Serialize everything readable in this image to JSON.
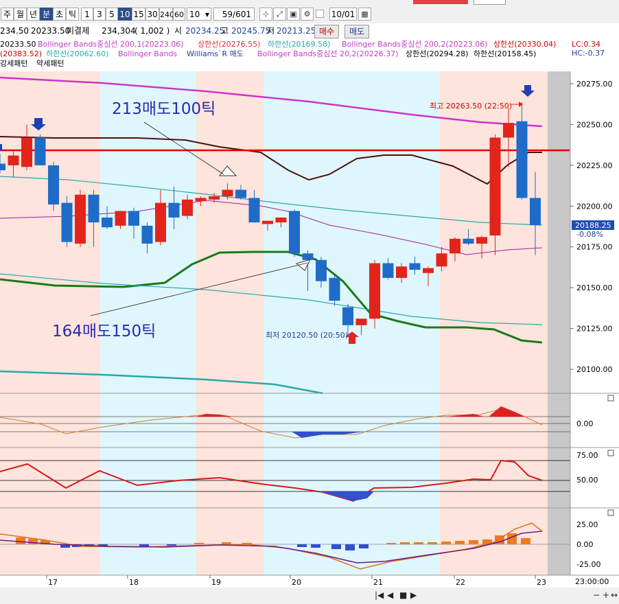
{
  "toolbar": {
    "periods": [
      "주",
      "월",
      "년",
      "분",
      "초",
      "틱"
    ],
    "active_period": "분",
    "intervals": [
      "1",
      "3",
      "5",
      "10",
      "15",
      "30",
      "240",
      "60"
    ],
    "active_interval": "10",
    "count_select": "10",
    "range": "59/601",
    "date_value": "10/01"
  },
  "quote": {
    "p1": "234.50",
    "p2": "20233.50",
    "open_interest_label": "미결제",
    "open_interest": "234,304",
    "oi_change": "( 1,002 )",
    "open_label": "시",
    "open": "20234.25",
    "high_label": "고",
    "high": "20245.75",
    "low_label": "저",
    "low": "20213.25",
    "buy_label": "매수",
    "sell_label": "매도"
  },
  "legend": {
    "l1a": "20233.50",
    "l1b": "Bollinger Bands중심선 200,1(20223.06)",
    "l1c": "상한선(20276.55)",
    "l1d": "하한선(20169.58)",
    "l1e": "Bollinger Bands중심선 200,2(20223.06)",
    "l1f": "상한선(20330.04)",
    "l2a": "(20383.52)",
    "l2b": "하한선(20062.60)",
    "l2c": "Bollinger Bands",
    "l2d": "Williams`R 매도",
    "l2e": "Bollinger Bands중심선 20,2(20226.37)",
    "l2f": "상한선(20294.28)",
    "l2g": "하한선(20158.45)",
    "l3a": "강세패턴",
    "l3b": "약세패턴",
    "lc": "LC:0.34",
    "hc": "HC:-0.37"
  },
  "annotations": {
    "sell1": "213매도100틱",
    "sell2": "164매도150틱",
    "high_note": "최고 20263.50 (22:50)",
    "low_note": "최저 20120.50 (20:50)"
  },
  "price_box": {
    "price": "20188.25",
    "change": "-0.08%"
  },
  "bottom_right_time": "23:00:00",
  "colors": {
    "up": "#e3241b",
    "down": "#1f6cc8",
    "band_pink": "#fde4dc",
    "band_cyan": "#dff6fc",
    "ref_line": "#e60000",
    "bb_outer": "#cc33cc",
    "bb_dark": "#4a1010",
    "bb_green": "#187a18",
    "teal": "#2aa7a7"
  },
  "chart_data": {
    "type": "candlestick",
    "ylim": [
      20082,
      20290
    ],
    "y_ticks": [
      "20275.00",
      "20250.00",
      "20225.00",
      "20200.00",
      "20175.00",
      "20150.00",
      "20125.00",
      "20100.00"
    ],
    "x_ticks": [
      "17",
      "18",
      "19",
      "20",
      "21",
      "22",
      "23"
    ],
    "ref_line": 20234,
    "candles": [
      {
        "o": 20226,
        "h": 20232,
        "l": 20220,
        "c": 20222
      },
      {
        "o": 20225,
        "h": 20234,
        "l": 20218,
        "c": 20231
      },
      {
        "o": 20224,
        "h": 20250,
        "l": 20222,
        "c": 20242
      },
      {
        "o": 20242,
        "h": 20244,
        "l": 20225,
        "c": 20225
      },
      {
        "o": 20225,
        "h": 20227,
        "l": 20197,
        "c": 20201
      },
      {
        "o": 20202,
        "h": 20206,
        "l": 20175,
        "c": 20178
      },
      {
        "o": 20177,
        "h": 20210,
        "l": 20175,
        "c": 20207
      },
      {
        "o": 20207,
        "h": 20210,
        "l": 20175,
        "c": 20190
      },
      {
        "o": 20193,
        "h": 20200,
        "l": 20186,
        "c": 20187
      },
      {
        "o": 20188,
        "h": 20197,
        "l": 20186,
        "c": 20197
      },
      {
        "o": 20197,
        "h": 20199,
        "l": 20180,
        "c": 20188
      },
      {
        "o": 20188,
        "h": 20190,
        "l": 20171,
        "c": 20177
      },
      {
        "o": 20178,
        "h": 20210,
        "l": 20176,
        "c": 20202
      },
      {
        "o": 20202,
        "h": 20212,
        "l": 20186,
        "c": 20193
      },
      {
        "o": 20194,
        "h": 20207,
        "l": 20192,
        "c": 20204
      },
      {
        "o": 20203,
        "h": 20206,
        "l": 20200,
        "c": 20205
      },
      {
        "o": 20204,
        "h": 20208,
        "l": 20202,
        "c": 20206
      },
      {
        "o": 20206,
        "h": 20214,
        "l": 20204,
        "c": 20210
      },
      {
        "o": 20210,
        "h": 20213,
        "l": 20204,
        "c": 20205
      },
      {
        "o": 20205,
        "h": 20210,
        "l": 20190,
        "c": 20190
      },
      {
        "o": 20189,
        "h": 20191,
        "l": 20185,
        "c": 20191
      },
      {
        "o": 20190,
        "h": 20193,
        "l": 20187,
        "c": 20193
      },
      {
        "o": 20197,
        "h": 20198,
        "l": 20169,
        "c": 20171
      },
      {
        "o": 20171,
        "h": 20173,
        "l": 20148,
        "c": 20167
      },
      {
        "o": 20167,
        "h": 20169,
        "l": 20150,
        "c": 20154
      },
      {
        "o": 20156,
        "h": 20158,
        "l": 20139,
        "c": 20142
      },
      {
        "o": 20138,
        "h": 20140,
        "l": 20120,
        "c": 20127
      },
      {
        "o": 20127,
        "h": 20131,
        "l": 20121,
        "c": 20131
      },
      {
        "o": 20131,
        "h": 20167,
        "l": 20125,
        "c": 20165
      },
      {
        "o": 20165,
        "h": 20168,
        "l": 20155,
        "c": 20156
      },
      {
        "o": 20156,
        "h": 20165,
        "l": 20153,
        "c": 20163
      },
      {
        "o": 20165,
        "h": 20169,
        "l": 20158,
        "c": 20161
      },
      {
        "o": 20159,
        "h": 20163,
        "l": 20151,
        "c": 20162
      },
      {
        "o": 20163,
        "h": 20175,
        "l": 20160,
        "c": 20171
      },
      {
        "o": 20171,
        "h": 20181,
        "l": 20166,
        "c": 20180
      },
      {
        "o": 20180,
        "h": 20186,
        "l": 20176,
        "c": 20177
      },
      {
        "o": 20177,
        "h": 20182,
        "l": 20168,
        "c": 20181
      },
      {
        "o": 20182,
        "h": 20244,
        "l": 20170,
        "c": 20242
      },
      {
        "o": 20242,
        "h": 20260,
        "l": 20224,
        "c": 20251
      },
      {
        "o": 20252,
        "h": 20263.5,
        "l": 20204,
        "c": 20205
      },
      {
        "o": 20205,
        "h": 20221,
        "l": 20170,
        "c": 20188.25
      }
    ]
  },
  "panels": {
    "p1_ticks": [
      "0.00"
    ],
    "p2_ticks": [
      "75.00",
      "50.00"
    ],
    "p3_ticks": [
      "25.00",
      "0.00",
      "-25.00"
    ]
  }
}
